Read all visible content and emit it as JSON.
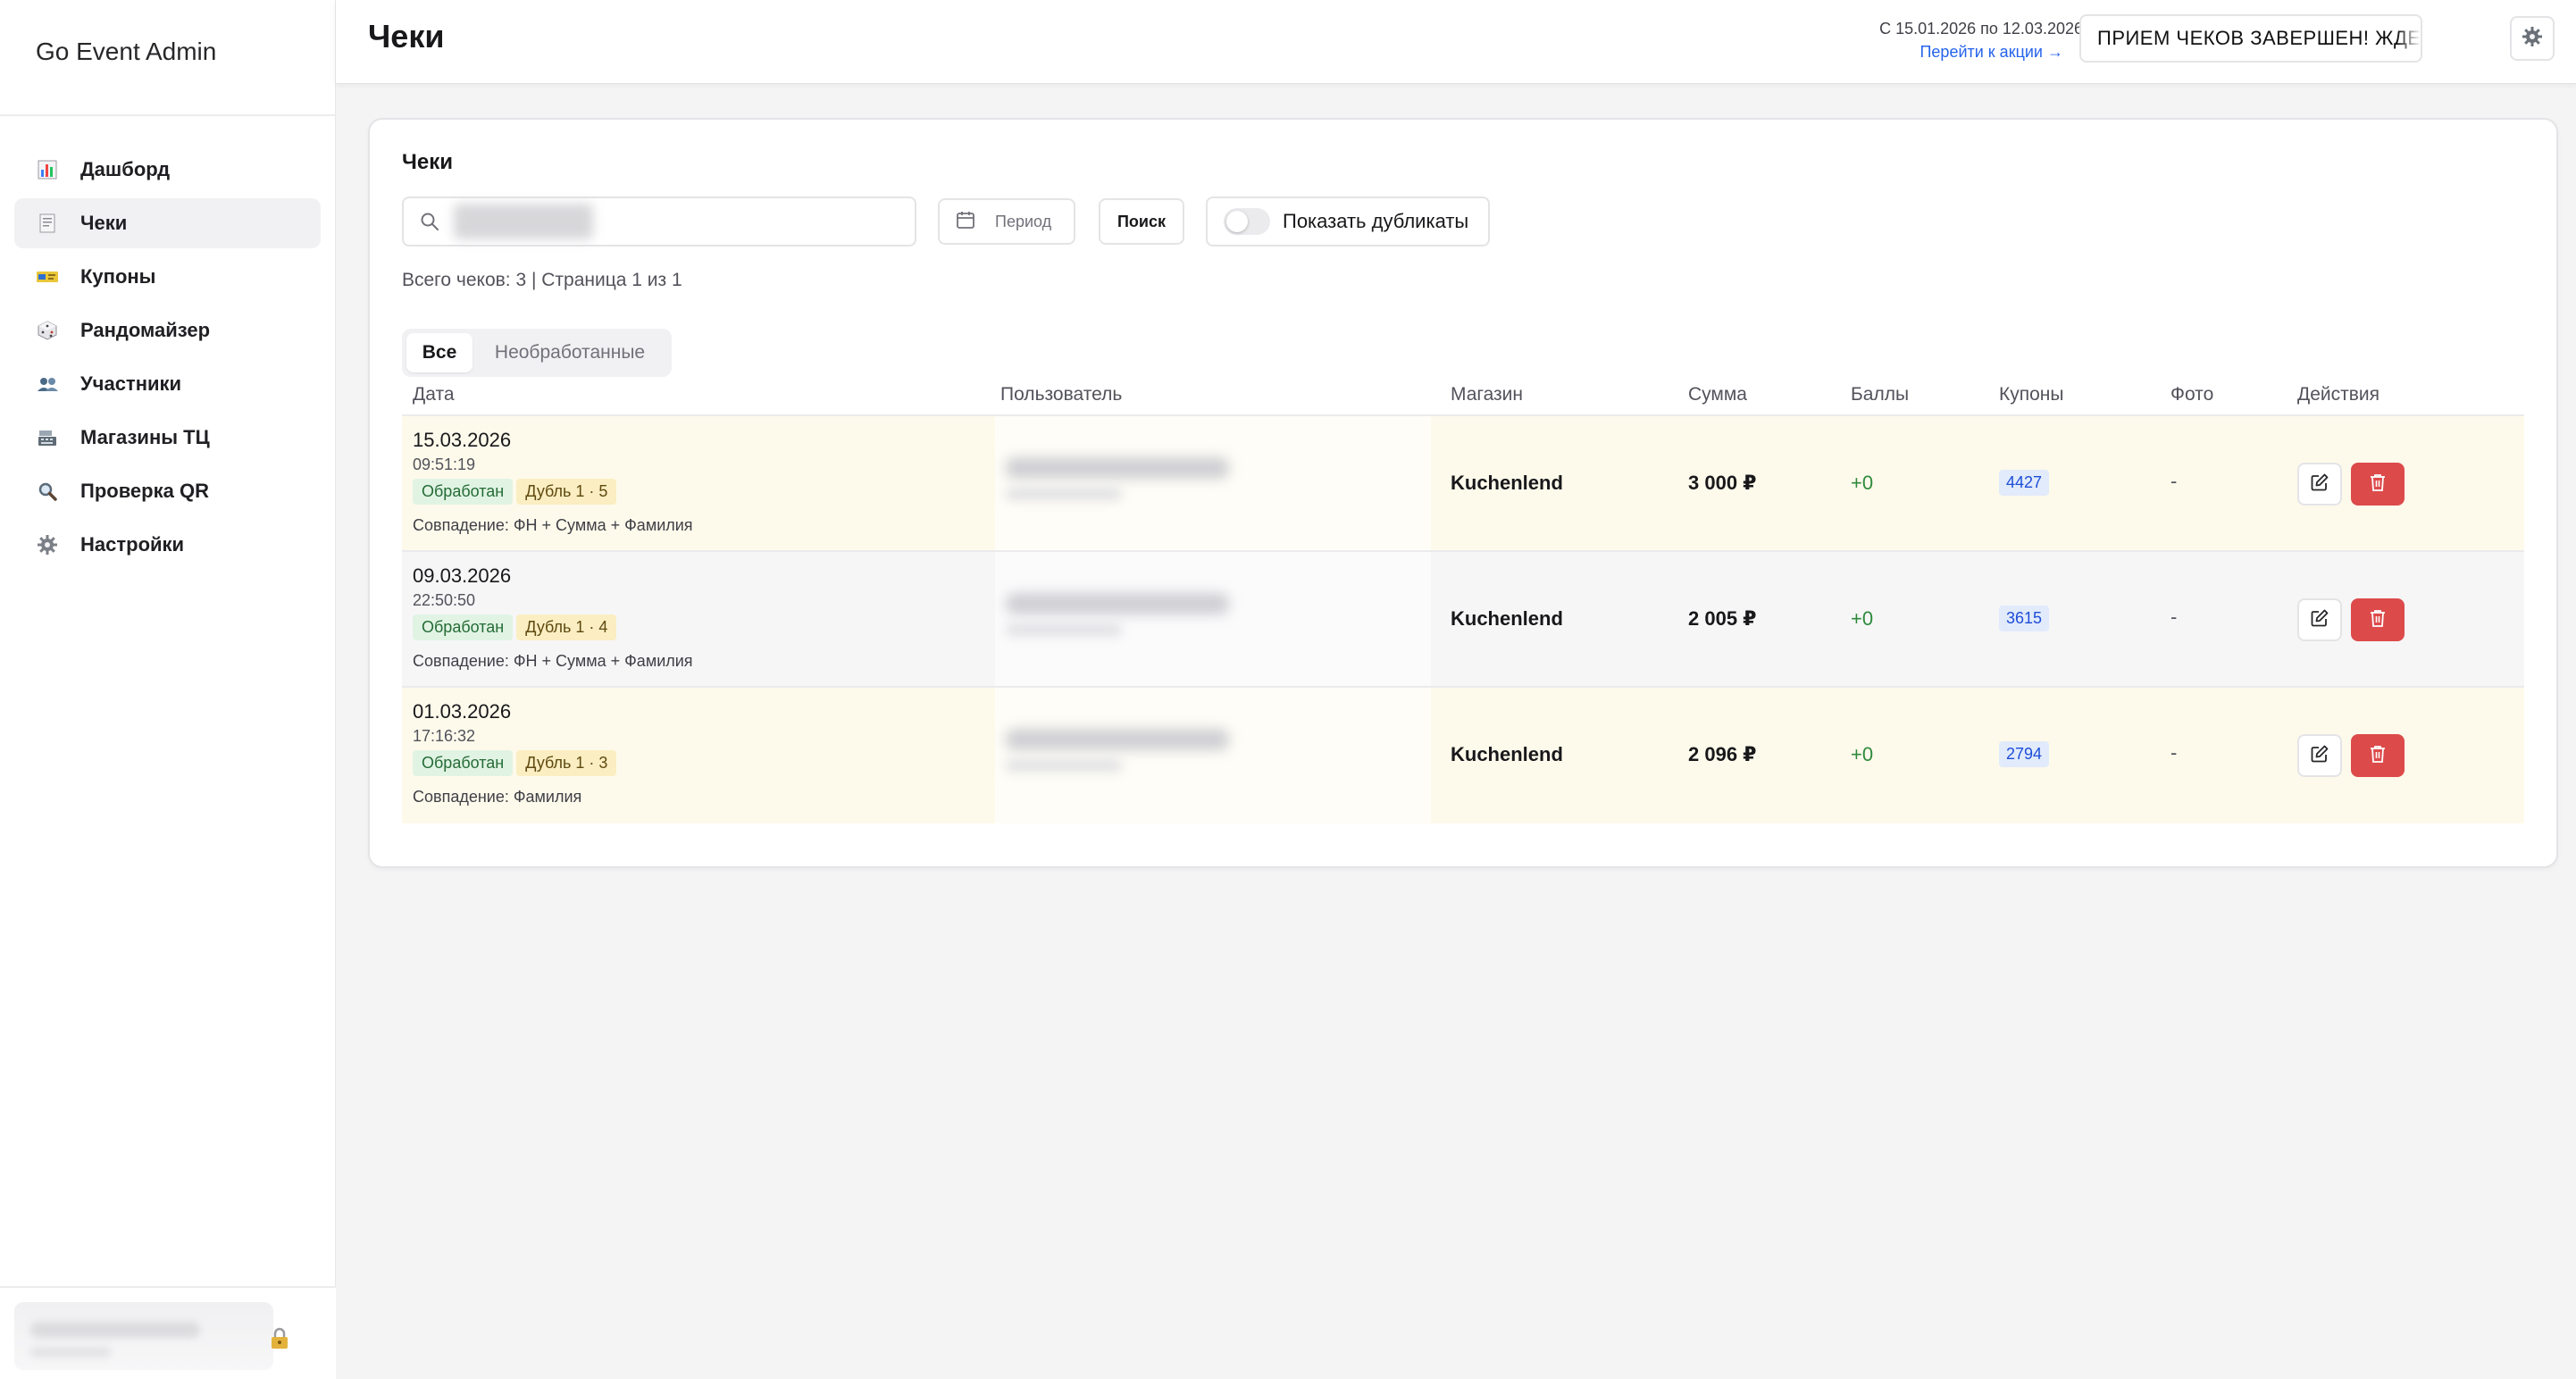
{
  "app": {
    "title": "Go Event Admin"
  },
  "sidebar": {
    "items": [
      {
        "label": "Дашборд",
        "icon": "bar-chart-icon",
        "active": false
      },
      {
        "label": "Чеки",
        "icon": "receipt-icon",
        "active": true
      },
      {
        "label": "Купоны",
        "icon": "ticket-icon",
        "active": false
      },
      {
        "label": "Рандомайзер",
        "icon": "dice-icon",
        "active": false
      },
      {
        "label": "Участники",
        "icon": "people-icon",
        "active": false
      },
      {
        "label": "Магазины ТЦ",
        "icon": "cash-register-icon",
        "active": false
      },
      {
        "label": "Проверка QR",
        "icon": "magnifier-icon",
        "active": false
      },
      {
        "label": "Настройки",
        "icon": "gear-icon",
        "active": false
      }
    ],
    "user_card": {
      "icon": "lock-icon"
    }
  },
  "header": {
    "title": "Чеки",
    "promo_dates": "С 15.01.2026 по 12.03.2026",
    "promo_link": "Перейти к акции →",
    "promo_status": "ПРИЕМ ЧЕКОВ ЗАВЕРШЕН! ЖДЕ"
  },
  "card": {
    "title": "Чеки",
    "search": {
      "placeholder": "",
      "value": ""
    },
    "period_label": "Период",
    "find_label": "Поиск",
    "duplicates_label": "Показать дубликаты",
    "duplicates_on": false,
    "summary": "Всего чеков: 3 | Страница 1 из 1",
    "tabs": [
      {
        "label": "Все",
        "active": true
      },
      {
        "label": "Необработанные",
        "active": false
      }
    ]
  },
  "table": {
    "columns": [
      "Дата",
      "Пользователь",
      "Магазин",
      "Сумма",
      "Баллы",
      "Купоны",
      "Фото",
      "Действия"
    ],
    "rows": [
      {
        "date": "15.03.2026",
        "time": "09:51:19",
        "status": "Обработан",
        "duplicate": "Дубль 1 · 5",
        "match": "Совпадение: ФН + Сумма + Фамилия",
        "shop": "Kuchenlend",
        "sum": "3 000 ₽",
        "points": "+0",
        "coupon": "4427",
        "photo": "-"
      },
      {
        "date": "09.03.2026",
        "time": "22:50:50",
        "status": "Обработан",
        "duplicate": "Дубль 1 · 4",
        "match": "Совпадение: ФН + Сумма + Фамилия",
        "shop": "Kuchenlend",
        "sum": "2 005 ₽",
        "points": "+0",
        "coupon": "3615",
        "photo": "-"
      },
      {
        "date": "01.03.2026",
        "time": "17:16:32",
        "status": "Обработан",
        "duplicate": "Дубль 1 · 3",
        "match": "Совпадение: Фамилия",
        "shop": "Kuchenlend",
        "sum": "2 096 ₽",
        "points": "+0",
        "coupon": "2794",
        "photo": "-"
      }
    ]
  },
  "colors": {
    "accent_link": "#2563eb",
    "delete": "#dd4a4a",
    "row_highlight": "#fdfaeb",
    "points_green": "#2f8a3c",
    "coupon_blue": "#1d4ed8"
  }
}
